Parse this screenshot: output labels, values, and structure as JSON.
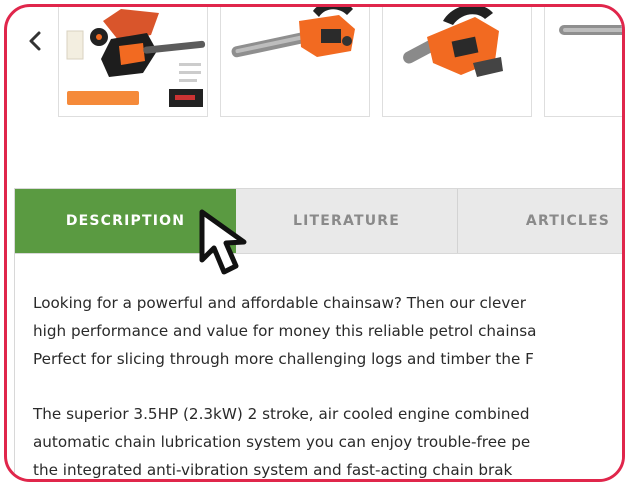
{
  "tabs": {
    "description": "DESCRIPTION",
    "literature": "LITERATURE",
    "articles": "ARTICLES",
    "active": "description"
  },
  "description": {
    "paragraph1": [
      "Looking for a powerful and affordable chainsaw? Then our clever",
      "high performance and value for money this reliable petrol chainsa",
      "Perfect for slicing through more challenging logs and timber the F"
    ],
    "paragraph2": [
      "The superior 3.5HP (2.3kW) 2 stroke, air cooled engine combined",
      "automatic chain lubrication system you can enjoy trouble-free pe",
      "the integrated anti-vibration system and fast-acting chain brak"
    ]
  },
  "colors": {
    "frame": "#e0264b",
    "active_tab": "#5a9a41",
    "chainsaw_body": "#f26a21"
  },
  "icons": {
    "carousel_prev": "chevron-left-icon",
    "pointer": "mouse-pointer-icon"
  }
}
